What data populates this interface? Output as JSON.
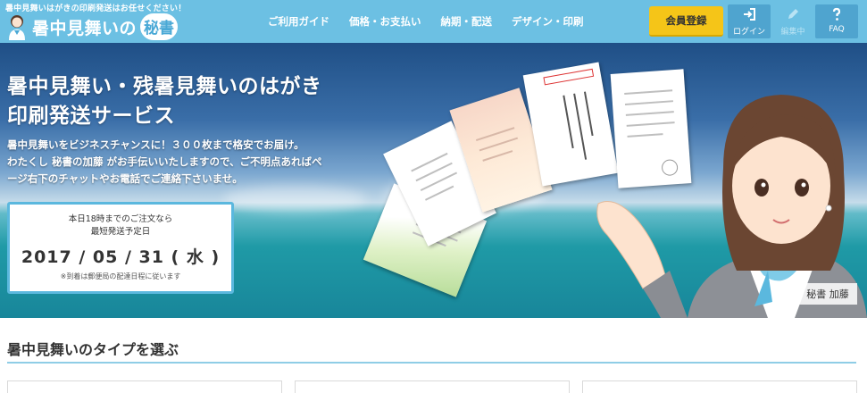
{
  "header": {
    "tagline": "暑中見舞いはがきの印刷発送はお任せください！",
    "logo_text": "暑中見舞いの",
    "logo_badge": "秘書",
    "nav": [
      "ご利用ガイド",
      "価格・お支払い",
      "納期・配送",
      "デザイン・印刷"
    ],
    "register_label": "会員登録",
    "login_label": "ログイン",
    "edit_label": "編集中",
    "faq_label": "FAQ"
  },
  "hero": {
    "title_line1": "暑中見舞い・残暑見舞いのはがき",
    "title_line2": "印刷発送サービス",
    "desc_line1": "暑中見舞いをビジネスチャンスに！３００枚まで格安でお届け。",
    "desc_line2": "わたくし 秘書の加藤 がお手伝いいたしますので、ご不明点あればペ",
    "desc_line3": "ージ右下のチャットやお電話でご連絡下さいませ。",
    "ship_line1": "本日18時までのご注文なら",
    "ship_line2": "最短発送予定日",
    "ship_date": "2017 / 05 / 31 ( 水 )",
    "ship_note": "※到着は郵便局の配達日程に従います",
    "character_name": "秘書 加藤"
  },
  "section": {
    "title": "暑中見舞いのタイプを選ぶ"
  },
  "colors": {
    "header_bg": "#6cc0e3",
    "register_bg": "#f5c518",
    "button_bg": "#4fa4cf",
    "accent_border": "#5bb8de"
  },
  "icons": {
    "login": "sign-in-icon",
    "edit": "pencil-icon",
    "faq": "question-icon"
  }
}
